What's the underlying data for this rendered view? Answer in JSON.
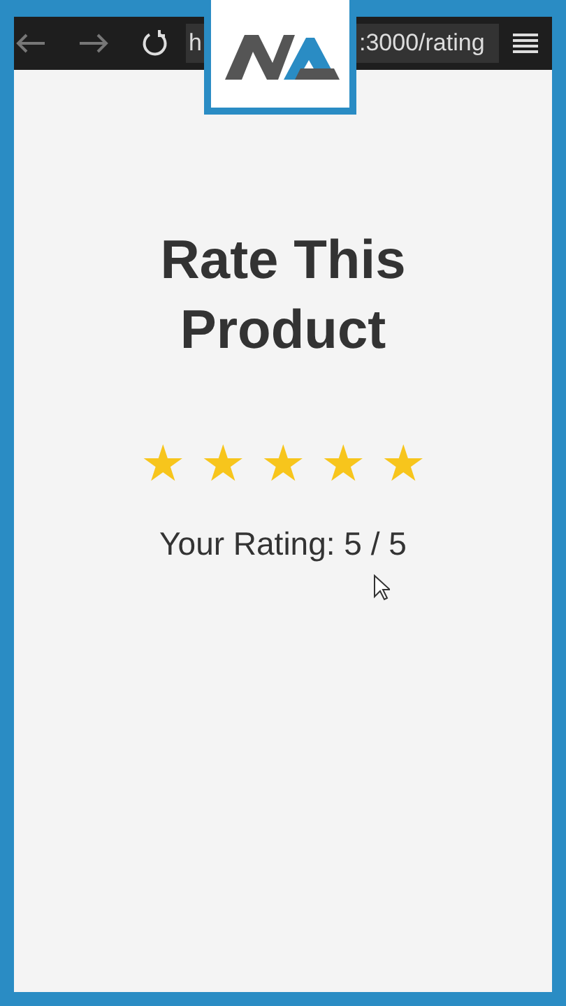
{
  "browser": {
    "url_start": "h",
    "url_end": ":3000/rating"
  },
  "page": {
    "title": "Rate This Product",
    "stars": 5,
    "star_glyph": "★",
    "rating_text": "Your Rating: 5 / 5"
  }
}
